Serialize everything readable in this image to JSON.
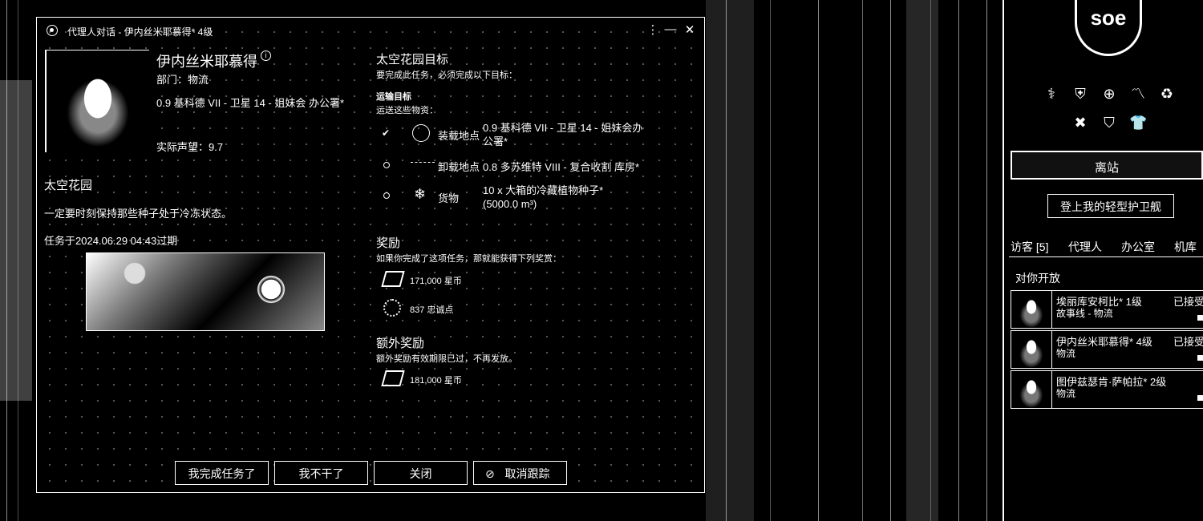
{
  "window": {
    "title": "代理人对话 - 伊内丝米耶慕得* 4级"
  },
  "agent": {
    "name": "伊内丝米耶慕得",
    "info_mark": "i",
    "department": "部门：物流",
    "location": "0.9 基科德 VII - 卫星 14 - 姐妹会 办公署*",
    "standing": "实际声望：9.7"
  },
  "mission": {
    "title": "太空花园",
    "description": "一定要时刻保持那些种子处于冷冻状态。",
    "expiry": "任务于2024.06.29 04:43过期"
  },
  "objectives": {
    "header": "太空花园目标",
    "intro": "要完成此任务，必须完成以下目标：",
    "transport_title": "运输目标",
    "transport_intro": "运送这些物资：",
    "rows": [
      {
        "status": "✔",
        "label": "装载地点",
        "value": "0.9 基科德 VII - 卫星 14 - 姐妹会办公署*"
      },
      {
        "status": "○",
        "label": "卸载地点",
        "value": "0.8 多苏维特 VIII - 复合收割 库房*"
      },
      {
        "status": "○",
        "label": "货物",
        "value": "10 x 大箱的冷藏植物种子* (5000.0 m³)"
      }
    ]
  },
  "rewards": {
    "title": "奖励",
    "intro": "如果你完成了这项任务，那就能获得下列奖赏：",
    "isk": "171,000 星币",
    "lp": "837 忠诚点"
  },
  "bonus": {
    "title": "额外奖励",
    "intro": "额外奖励有效期限已过，不再发放。",
    "isk": "181,000 星币"
  },
  "buttons": {
    "complete": "我完成任务了",
    "quit": "我不干了",
    "close": "关闭",
    "untrack": "取消跟踪"
  },
  "station": {
    "logo": "soe",
    "undock": "离站",
    "board": "登上我的轻型护卫舰",
    "tabs": [
      "访客 [5]",
      "代理人",
      "办公室",
      "机库"
    ],
    "open_header": "对你开放",
    "agents": [
      {
        "name": "埃丽库安柯比* 1级",
        "division": "故事线 - 物流",
        "status": "已接受"
      },
      {
        "name": "伊内丝米耶慕得* 4级",
        "division": "物流",
        "status": "已接受"
      },
      {
        "name": "图伊兹瑟肯·萨帕拉* 2级",
        "division": "物流",
        "status": ""
      }
    ]
  }
}
